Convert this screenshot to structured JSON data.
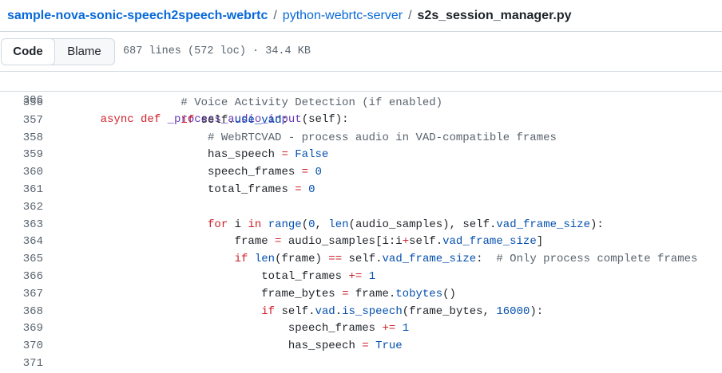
{
  "breadcrumb": {
    "repo": "sample-nova-sonic-speech2speech-webrtc",
    "folder": "python-webrtc-server",
    "file": "s2s_session_manager.py",
    "separator": "/"
  },
  "toolbar": {
    "code_label": "Code",
    "blame_label": "Blame",
    "file_info": "687 lines (572 loc) · 34.4 KB"
  },
  "sticky_line": {
    "number": "306",
    "code": [
      {
        "t": "    "
      },
      {
        "t": "async",
        "c": "kw"
      },
      {
        "t": " "
      },
      {
        "t": "def",
        "c": "kw"
      },
      {
        "t": " "
      },
      {
        "t": "_process_audio_input",
        "c": "fn"
      },
      {
        "t": "(self):"
      }
    ]
  },
  "lines": [
    {
      "number": "356",
      "code": [
        {
          "t": "                # Voice Activity Detection (if enabled)",
          "c": "cm"
        }
      ]
    },
    {
      "number": "357",
      "code": [
        {
          "t": "                "
        },
        {
          "t": "if",
          "c": "kw"
        },
        {
          "t": " self."
        },
        {
          "t": "use_vad",
          "c": "prop"
        },
        {
          "t": ":"
        }
      ]
    },
    {
      "number": "358",
      "code": [
        {
          "t": "                    # WebRTCVAD - process audio in VAD-compatible frames",
          "c": "cm"
        }
      ]
    },
    {
      "number": "359",
      "code": [
        {
          "t": "                    has_speech "
        },
        {
          "t": "=",
          "c": "kw"
        },
        {
          "t": " "
        },
        {
          "t": "False",
          "c": "num"
        }
      ]
    },
    {
      "number": "360",
      "code": [
        {
          "t": "                    speech_frames "
        },
        {
          "t": "=",
          "c": "kw"
        },
        {
          "t": " "
        },
        {
          "t": "0",
          "c": "num"
        }
      ]
    },
    {
      "number": "361",
      "code": [
        {
          "t": "                    total_frames "
        },
        {
          "t": "=",
          "c": "kw"
        },
        {
          "t": " "
        },
        {
          "t": "0",
          "c": "num"
        }
      ]
    },
    {
      "number": "362",
      "code": [
        {
          "t": ""
        }
      ]
    },
    {
      "number": "363",
      "code": [
        {
          "t": "                    "
        },
        {
          "t": "for",
          "c": "kw"
        },
        {
          "t": " i "
        },
        {
          "t": "in",
          "c": "kw"
        },
        {
          "t": " "
        },
        {
          "t": "range",
          "c": "prop"
        },
        {
          "t": "("
        },
        {
          "t": "0",
          "c": "num"
        },
        {
          "t": ", "
        },
        {
          "t": "len",
          "c": "prop"
        },
        {
          "t": "(audio_samples), self."
        },
        {
          "t": "vad_frame_size",
          "c": "prop"
        },
        {
          "t": "):"
        }
      ]
    },
    {
      "number": "364",
      "code": [
        {
          "t": "                        frame "
        },
        {
          "t": "=",
          "c": "kw"
        },
        {
          "t": " audio_samples[i:i"
        },
        {
          "t": "+",
          "c": "kw"
        },
        {
          "t": "self."
        },
        {
          "t": "vad_frame_size",
          "c": "prop"
        },
        {
          "t": "]"
        }
      ]
    },
    {
      "number": "365",
      "code": [
        {
          "t": "                        "
        },
        {
          "t": "if",
          "c": "kw"
        },
        {
          "t": " "
        },
        {
          "t": "len",
          "c": "prop"
        },
        {
          "t": "(frame) "
        },
        {
          "t": "==",
          "c": "kw"
        },
        {
          "t": " self."
        },
        {
          "t": "vad_frame_size",
          "c": "prop"
        },
        {
          "t": ":  "
        },
        {
          "t": "# Only process complete frames",
          "c": "cm"
        }
      ]
    },
    {
      "number": "366",
      "code": [
        {
          "t": "                            total_frames "
        },
        {
          "t": "+=",
          "c": "kw"
        },
        {
          "t": " "
        },
        {
          "t": "1",
          "c": "num"
        }
      ]
    },
    {
      "number": "367",
      "code": [
        {
          "t": "                            frame_bytes "
        },
        {
          "t": "=",
          "c": "kw"
        },
        {
          "t": " frame."
        },
        {
          "t": "tobytes",
          "c": "prop"
        },
        {
          "t": "()"
        }
      ]
    },
    {
      "number": "368",
      "code": [
        {
          "t": "                            "
        },
        {
          "t": "if",
          "c": "kw"
        },
        {
          "t": " self."
        },
        {
          "t": "vad",
          "c": "prop"
        },
        {
          "t": "."
        },
        {
          "t": "is_speech",
          "c": "prop"
        },
        {
          "t": "(frame_bytes, "
        },
        {
          "t": "16000",
          "c": "num"
        },
        {
          "t": "):"
        }
      ]
    },
    {
      "number": "369",
      "code": [
        {
          "t": "                                speech_frames "
        },
        {
          "t": "+=",
          "c": "kw"
        },
        {
          "t": " "
        },
        {
          "t": "1",
          "c": "num"
        }
      ]
    },
    {
      "number": "370",
      "code": [
        {
          "t": "                                has_speech "
        },
        {
          "t": "=",
          "c": "kw"
        },
        {
          "t": " "
        },
        {
          "t": "True",
          "c": "num"
        }
      ]
    },
    {
      "number": "371",
      "code": [
        {
          "t": ""
        }
      ]
    }
  ]
}
